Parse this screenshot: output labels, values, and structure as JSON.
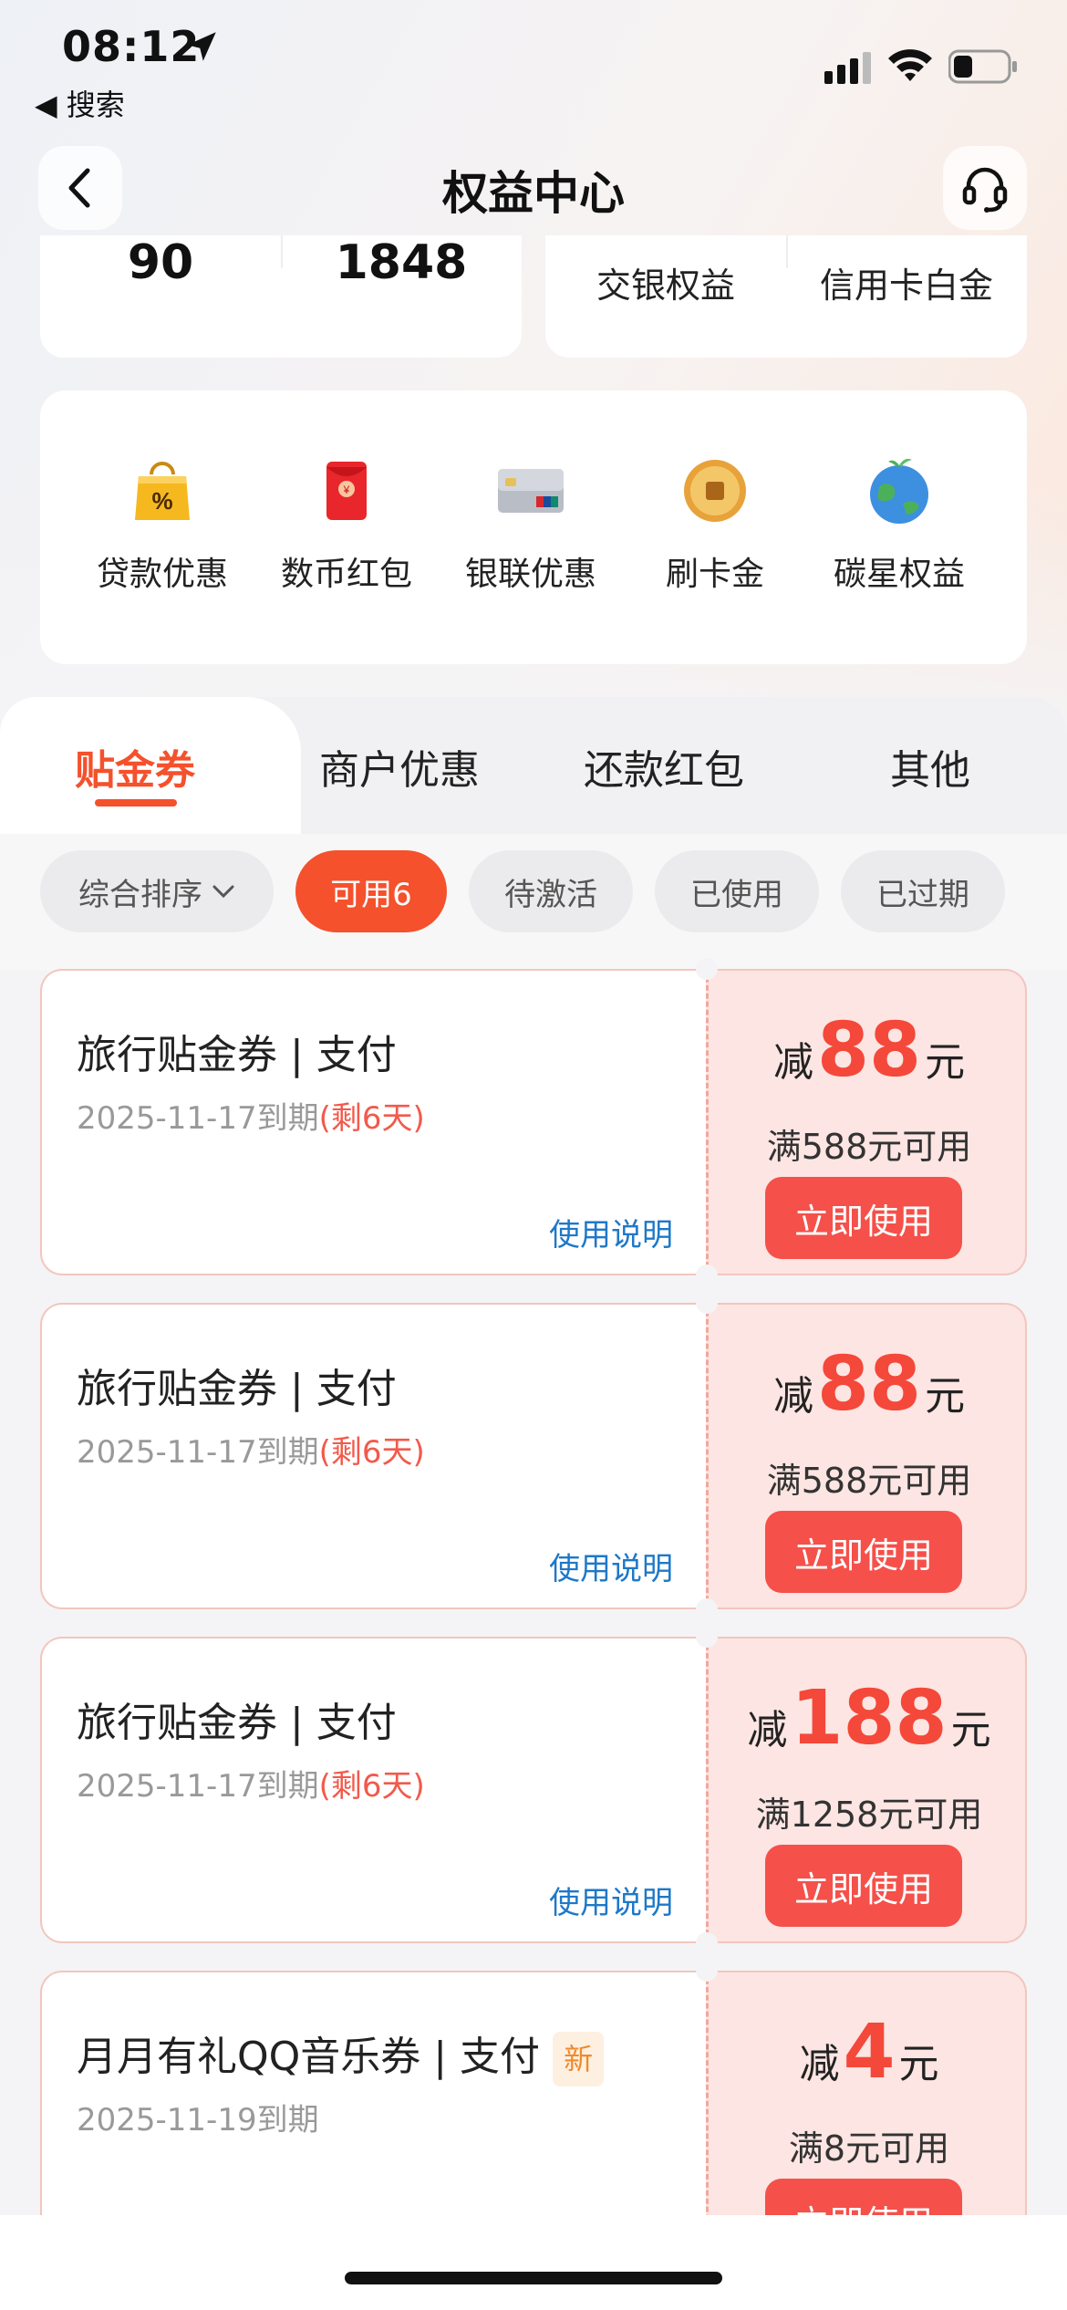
{
  "status_bar": {
    "time": "08:12",
    "back_app": "◀ 搜索"
  },
  "nav": {
    "title": "权益中心"
  },
  "summary": {
    "stat_a": "90",
    "stat_b": "1848",
    "label_a": "交银权益",
    "label_b": "信用卡白金"
  },
  "benefits": [
    {
      "label": "贷款优惠",
      "icon": "shopping-bag-percent-icon"
    },
    {
      "label": "数币红包",
      "icon": "red-envelope-icon"
    },
    {
      "label": "银联优惠",
      "icon": "unionpay-card-icon"
    },
    {
      "label": "刷卡金",
      "icon": "gold-coin-icon"
    },
    {
      "label": "碳星权益",
      "icon": "earth-globe-icon"
    }
  ],
  "tabs": [
    {
      "label": "贴金券",
      "active": true
    },
    {
      "label": "商户优惠"
    },
    {
      "label": "还款红包"
    },
    {
      "label": "其他"
    }
  ],
  "filters": {
    "sort": "综合排序",
    "chips": [
      "可用6",
      "待激活",
      "已使用",
      "已过期"
    ]
  },
  "coupons": [
    {
      "title": "旅行贴金券 | 支付",
      "date": "2025-11-17到期",
      "remain": "(剩6天)",
      "help": "使用说明",
      "prefix": "减",
      "amount": "88",
      "suffix": "元",
      "condition": "满588元可用",
      "button": "立即使用"
    },
    {
      "title": "旅行贴金券 | 支付",
      "date": "2025-11-17到期",
      "remain": "(剩6天)",
      "help": "使用说明",
      "prefix": "减",
      "amount": "88",
      "suffix": "元",
      "condition": "满588元可用",
      "button": "立即使用"
    },
    {
      "title": "旅行贴金券 | 支付",
      "date": "2025-11-17到期",
      "remain": "(剩6天)",
      "help": "使用说明",
      "prefix": "减",
      "amount": "188",
      "suffix": "元",
      "condition": "满1258元可用",
      "button": "立即使用"
    },
    {
      "title": "月月有礼QQ音乐券 | 支付",
      "badge": "新",
      "date": "2025-11-19到期",
      "prefix": "减",
      "amount": "4",
      "suffix": "元",
      "condition": "满8元可用",
      "button": "立即使用"
    }
  ],
  "colors": {
    "accent": "#f4512c",
    "coupon_red": "#f4483a",
    "link_blue": "#1f78c8"
  }
}
